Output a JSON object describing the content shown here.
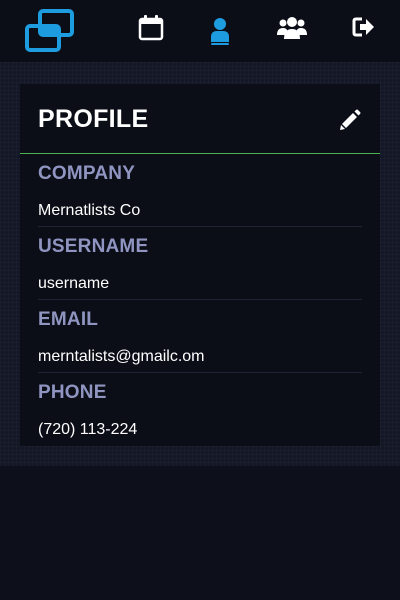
{
  "nav": {
    "items": [
      {
        "icon": "calendar-icon",
        "active": false
      },
      {
        "icon": "user-icon",
        "active": true
      },
      {
        "icon": "users-icon",
        "active": false
      },
      {
        "icon": "logout-icon",
        "active": false
      }
    ],
    "accent_color": "#1e9ce0"
  },
  "profile": {
    "title": "PROFILE",
    "fields": [
      {
        "label": "COMPANY",
        "value": "Mernatlists Co"
      },
      {
        "label": "USERNAME",
        "value": "username"
      },
      {
        "label": "EMAIL",
        "value": "merntalists@gmailc.om"
      },
      {
        "label": "PHONE",
        "value": "(720) 113-224"
      }
    ]
  },
  "colors": {
    "background": "#0d0f1a",
    "card": "#0b0d17",
    "label": "#8f95c0",
    "divider_accent": "#4caf50"
  }
}
